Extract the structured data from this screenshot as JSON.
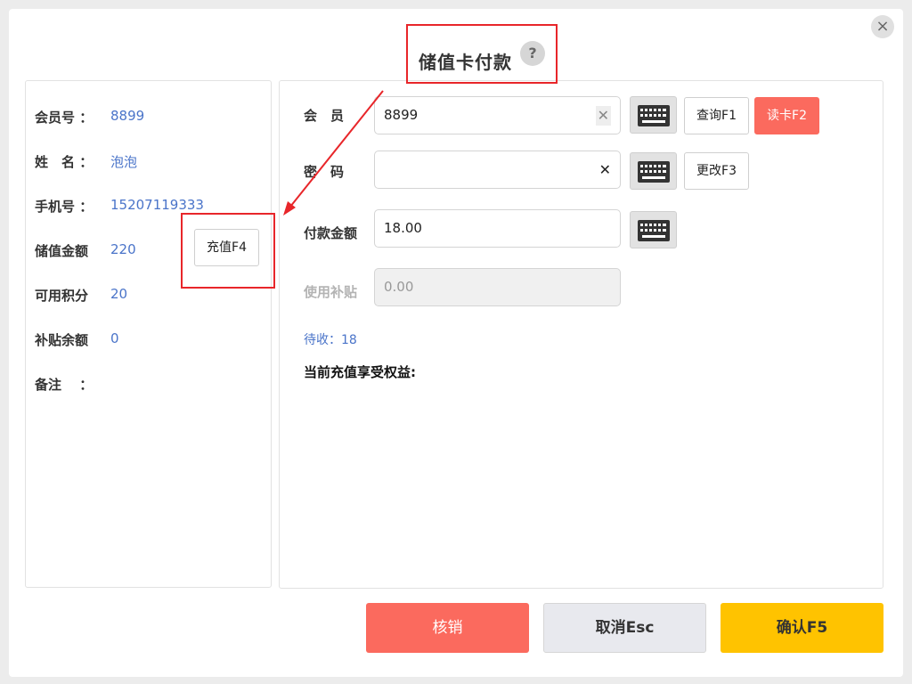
{
  "dialog": {
    "title": "储值卡付款",
    "help_glyph": "?",
    "close_glyph": "×"
  },
  "member_info": {
    "rows": [
      {
        "label": "会员号 ：",
        "value": "8899"
      },
      {
        "label": "姓　名 ：",
        "value": "泡泡"
      },
      {
        "label": "手机号 ：",
        "value": "15207119333"
      },
      {
        "label": "储值金额",
        "value": "220"
      },
      {
        "label": "可用积分",
        "value": "20"
      },
      {
        "label": "补贴余额",
        "value": "0"
      },
      {
        "label": "备注　 ：",
        "value": ""
      }
    ],
    "recharge_label": "充值F4"
  },
  "form": {
    "member_label": "会　员",
    "member_value": "8899",
    "password_label": "密　码",
    "password_value": "",
    "amount_label": "付款金额",
    "amount_value": "18.00",
    "subsidy_label": "使用补贴",
    "subsidy_value": "0.00",
    "clear_glyph": "✕",
    "query_label": "查询F1",
    "read_card_label": "读卡F2",
    "change_label": "更改F3",
    "pending_text": "待收：18",
    "benefit_text": "当前充值享受权益:"
  },
  "footer": {
    "void_label": "核销",
    "cancel_label": "取消Esc",
    "confirm_label": "确认F5"
  },
  "colors": {
    "accent_red": "#fb6a5e",
    "confirm_yellow": "#ffc300",
    "value_blue": "#4a74c9",
    "annotation_red": "#e8262a"
  }
}
